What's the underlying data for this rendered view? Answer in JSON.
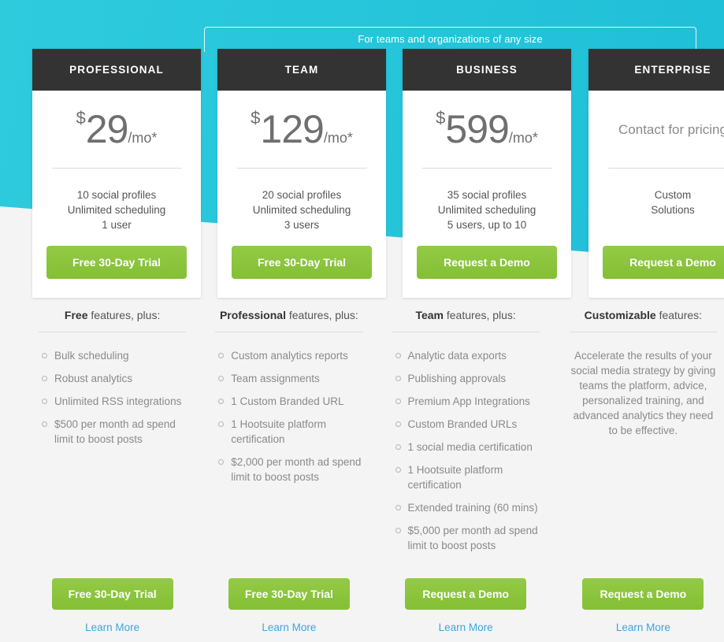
{
  "group_banner": {
    "label": "For teams and organizations of any size"
  },
  "plans": [
    {
      "name": "PROFESSIONAL",
      "currency": "$",
      "amount": "29",
      "period": "/mo*",
      "contact_price": null,
      "specs": [
        "10 social profiles",
        "Unlimited scheduling",
        "1 user"
      ],
      "card_cta": "Free 30-Day Trial",
      "features_heading_bold": "Free",
      "features_heading_rest": " features, plus:",
      "features": [
        "Bulk scheduling",
        "Robust analytics",
        "Unlimited RSS integrations",
        "$500 per month ad spend limit to boost posts"
      ],
      "paragraph": null,
      "bottom_cta": "Free 30-Day Trial",
      "learn_more": "Learn More"
    },
    {
      "name": "TEAM",
      "currency": "$",
      "amount": "129",
      "period": "/mo*",
      "contact_price": null,
      "specs": [
        "20 social profiles",
        "Unlimited scheduling",
        "3 users"
      ],
      "card_cta": "Free 30-Day Trial",
      "features_heading_bold": "Professional",
      "features_heading_rest": " features, plus:",
      "features": [
        "Custom analytics reports",
        "Team assignments",
        "1 Custom Branded URL",
        "1 Hootsuite platform certification",
        "$2,000 per month ad spend limit to boost posts"
      ],
      "paragraph": null,
      "bottom_cta": "Free 30-Day Trial",
      "learn_more": "Learn More"
    },
    {
      "name": "BUSINESS",
      "currency": "$",
      "amount": "599",
      "period": "/mo*",
      "contact_price": null,
      "specs": [
        "35 social profiles",
        "Unlimited scheduling",
        "5 users, up to 10"
      ],
      "card_cta": "Request a Demo",
      "features_heading_bold": "Team",
      "features_heading_rest": " features, plus:",
      "features": [
        "Analytic data exports",
        "Publishing approvals",
        "Premium App Integrations",
        "Custom Branded URLs",
        "1 social media certification",
        "1 Hootsuite platform certification",
        "Extended training (60 mins)",
        "$5,000 per month ad spend limit to boost posts"
      ],
      "paragraph": null,
      "bottom_cta": "Request a Demo",
      "learn_more": "Learn More"
    },
    {
      "name": "ENTERPRISE",
      "currency": null,
      "amount": null,
      "period": null,
      "contact_price": "Contact for pricing",
      "specs": [
        "Custom",
        "Solutions"
      ],
      "card_cta": "Request a Demo",
      "features_heading_bold": "Customizable",
      "features_heading_rest": " features:",
      "features": [],
      "paragraph": "Accelerate the results of your social media strategy by giving teams the platform, advice, personalized training, and advanced analytics they need to be effective.",
      "bottom_cta": "Request a Demo",
      "learn_more": "Learn More"
    }
  ],
  "colors": {
    "hero_cyan": "#25c6db",
    "card_header_dark": "#333333",
    "cta_green": "#8dc63f",
    "link_blue": "#3aa6e0",
    "page_background": "#f4f4f4"
  }
}
